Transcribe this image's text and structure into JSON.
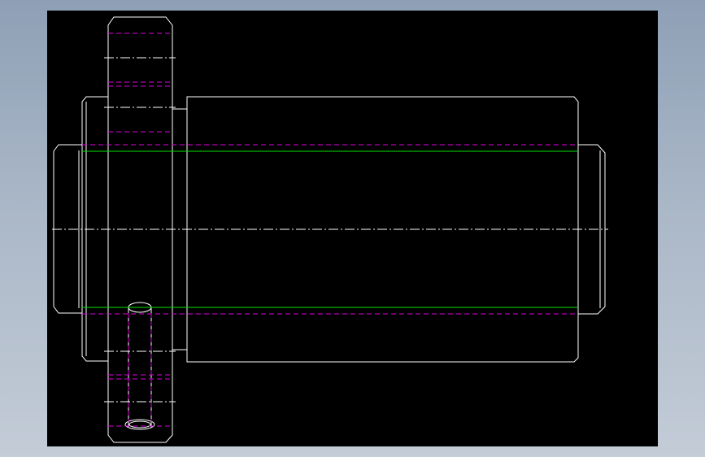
{
  "colors": {
    "background": "#000000",
    "outline": "#ffffff",
    "hidden_line": "#e000e0",
    "thread_line": "#00e000",
    "center_line": "#ffffff"
  }
}
